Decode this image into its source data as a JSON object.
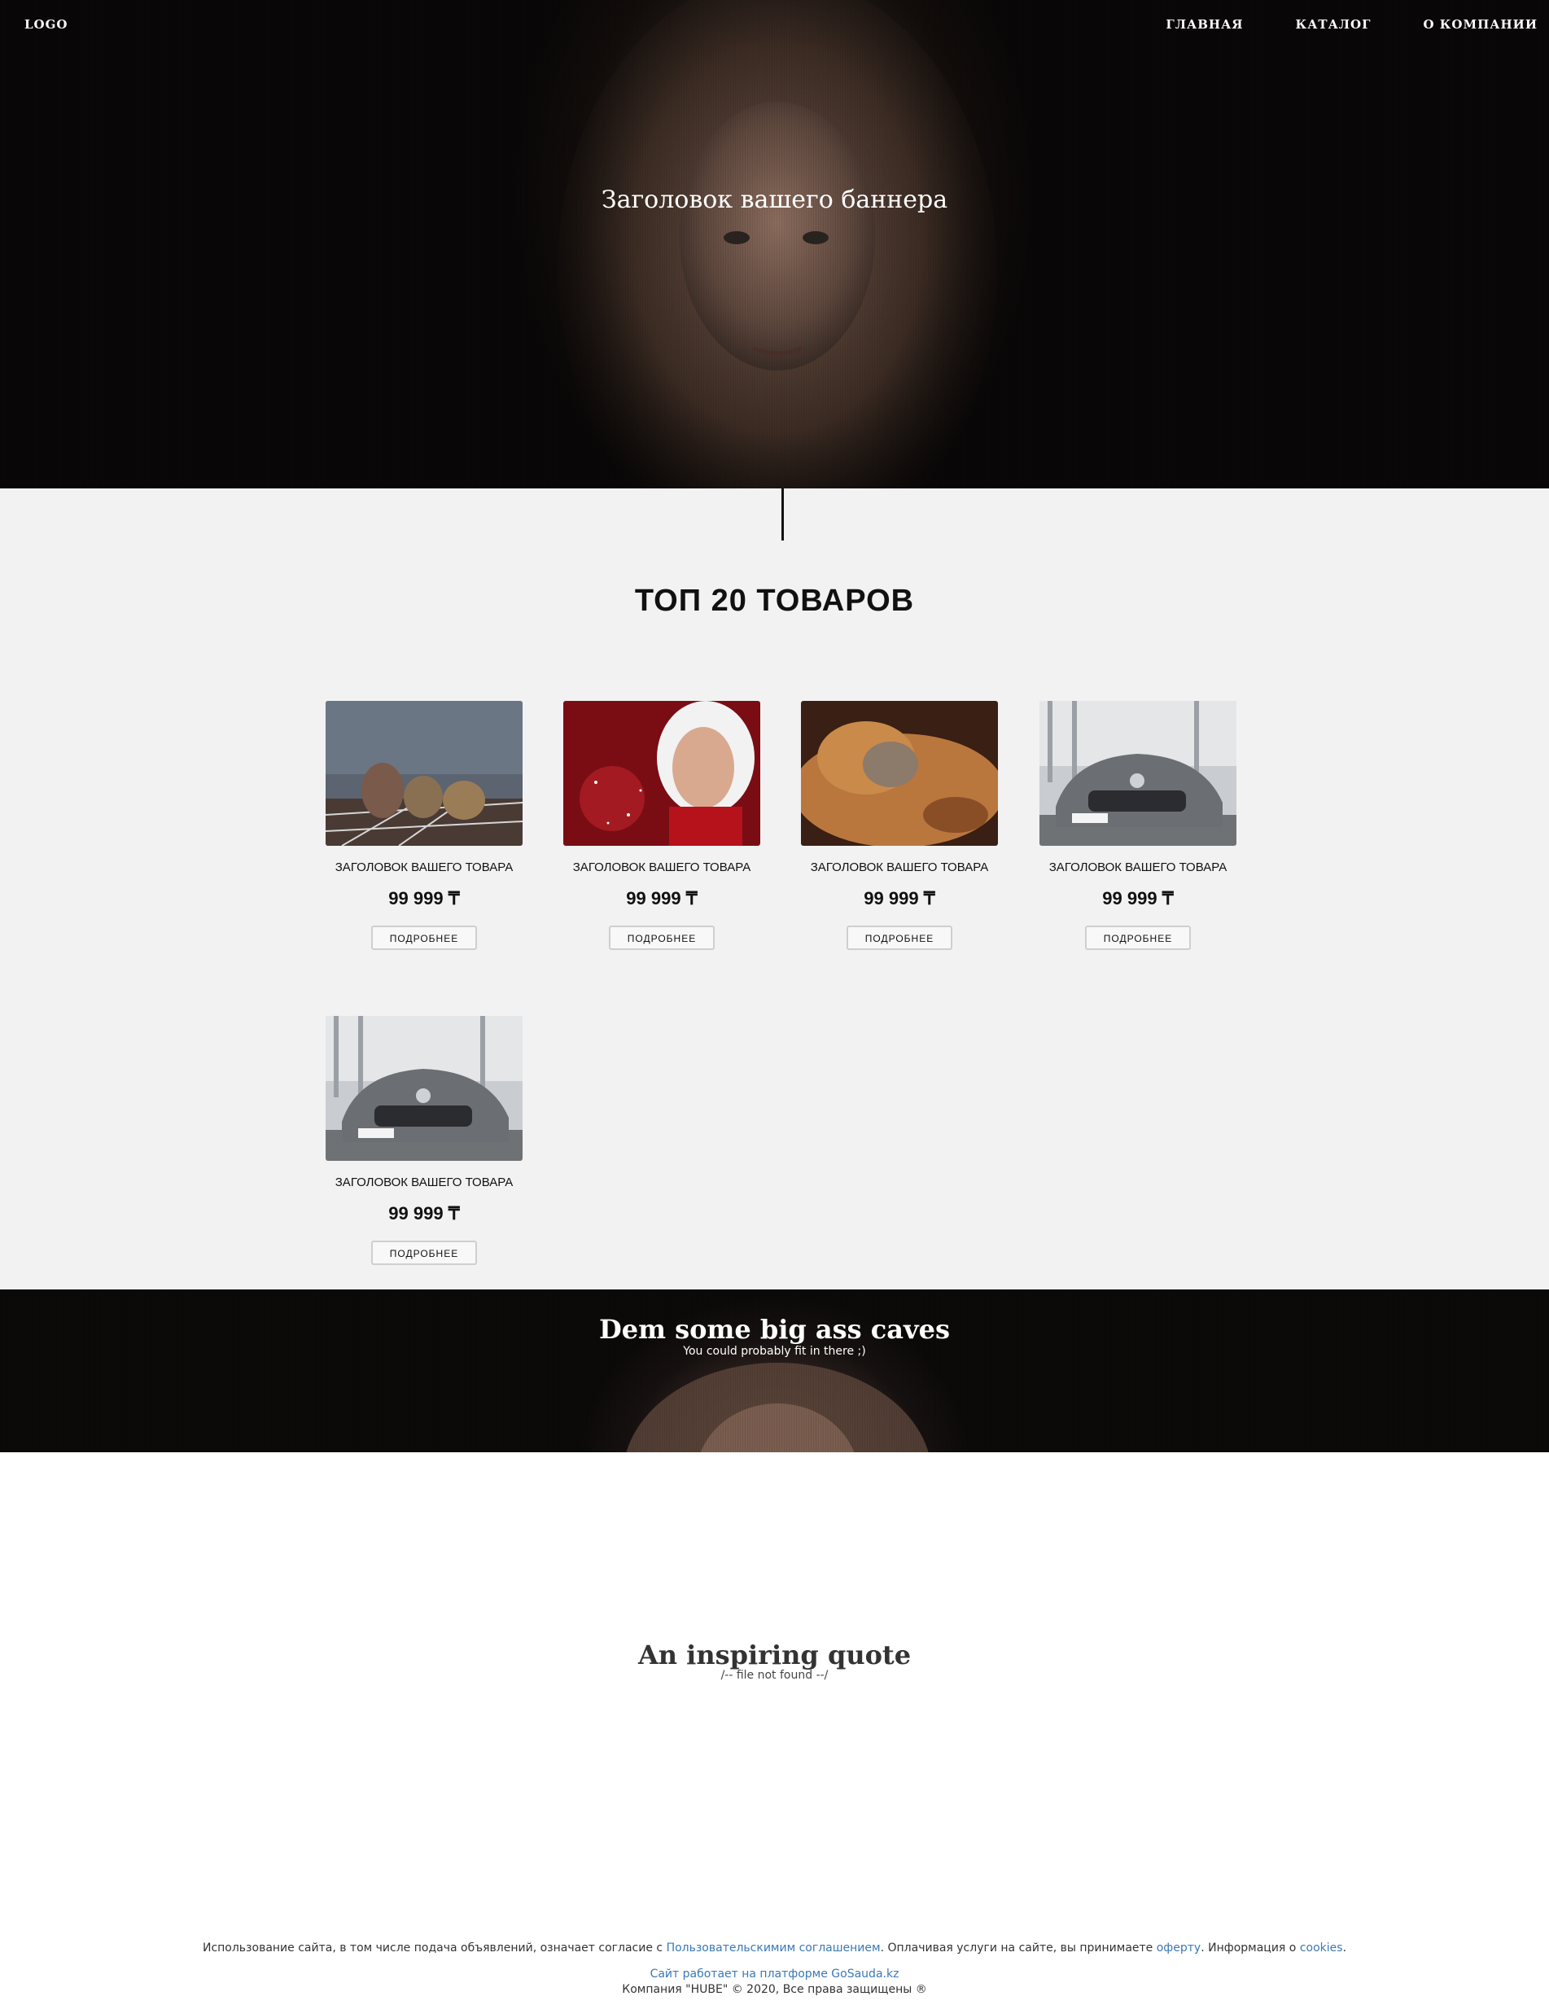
{
  "header": {
    "logo": "LOGO",
    "nav": [
      "ГЛАВНАЯ",
      "КАТАЛОГ",
      "О КОМПАНИИ"
    ]
  },
  "hero": {
    "title": "Заголовок вашего баннера"
  },
  "products": {
    "section_title": "ТОП 20 ТОВАРОВ",
    "items": [
      {
        "title": "ЗАГОЛОВОК ВАШЕГО ТОВАРА",
        "price": "99 999 ₸",
        "button": "ПОДРОБНЕЕ",
        "image": "athletes-photo"
      },
      {
        "title": "ЗАГОЛОВОК ВАШЕГО ТОВАРА",
        "price": "99 999 ₸",
        "button": "ПОДРОБНЕЕ",
        "image": "woman-red-hood-photo"
      },
      {
        "title": "ЗАГОЛОВОК ВАШЕГО ТОВАРА",
        "price": "99 999 ₸",
        "button": "ПОДРОБНЕЕ",
        "image": "dog-cat-photo"
      },
      {
        "title": "ЗАГОЛОВОК ВАШЕГО ТОВАРА",
        "price": "99 999 ₸",
        "button": "ПОДРОБНЕЕ",
        "image": "grey-car-photo"
      },
      {
        "title": "ЗАГОЛОВОК ВАШЕГО ТОВАРА",
        "price": "99 999 ₸",
        "button": "ПОДРОБНЕЕ",
        "image": "grey-car-photo"
      }
    ]
  },
  "caves": {
    "title": "Dem some big ass caves",
    "subtitle": "You could probably fit in there ;)"
  },
  "quote": {
    "title": "An inspiring quote",
    "subtitle": "/-- file not found --/"
  },
  "footer": {
    "terms_prefix": "Использование сайта, в том числе подача объявлений, означает согласие с ",
    "terms_link": "Пользовательскимим соглашением",
    "terms_middle": ". Оплачивая услуги на сайте, вы принимаете ",
    "offer_link": "оферту",
    "terms_info": ". Информация о ",
    "cookies_link": "cookies",
    "terms_end": ".",
    "platform_link": "Сайт работает на платформе GoSauda.kz",
    "copyright": "Компания \"HUBE\" © 2020, Все права защищены ®"
  },
  "colors": {
    "link": "#3a78b5",
    "section_bg": "#f2f2f2",
    "hero_bg": "#120d0b"
  }
}
